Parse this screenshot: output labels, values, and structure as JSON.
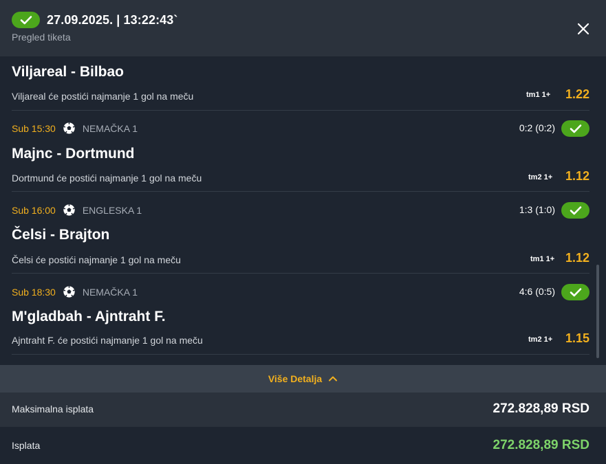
{
  "header": {
    "datetime": "27.09.2025. | 13:22:43`",
    "subtitle": "Pregled tiketa",
    "status_icon": "check-icon",
    "close_icon": "close-icon"
  },
  "colors": {
    "accent": "#f2b01e",
    "success": "#4ca61c",
    "payout": "#7ed46a",
    "background": "#1e2530",
    "panel": "#2b323c"
  },
  "matches": [
    {
      "kickoff": "",
      "league": "",
      "score": "",
      "teams": "Viljareal - Bilbao",
      "pick": "Viljareal će postići najmanje 1 gol na meču",
      "market": "tm1 1+",
      "odds": "1.22",
      "won": false
    },
    {
      "kickoff": "Sub 15:30",
      "league": "NEMAČKA 1",
      "score": "0:2 (0:2)",
      "teams": "Majnc - Dortmund",
      "pick": "Dortmund će postići najmanje 1 gol na meču",
      "market": "tm2 1+",
      "odds": "1.12",
      "won": true
    },
    {
      "kickoff": "Sub 16:00",
      "league": "ENGLESKA 1",
      "score": "1:3 (1:0)",
      "teams": "Čelsi - Brajton",
      "pick": "Čelsi će postići najmanje 1 gol na meču",
      "market": "tm1 1+",
      "odds": "1.12",
      "won": true
    },
    {
      "kickoff": "Sub 18:30",
      "league": "NEMAČKA 1",
      "score": "4:6 (0:5)",
      "teams": "M'gladbah - Ajntraht F.",
      "pick": "Ajntraht F. će postići najmanje 1 gol na meču",
      "market": "tm2 1+",
      "odds": "1.15",
      "won": true
    }
  ],
  "more_details": {
    "label": "Više Detalja",
    "icon": "chevron-up-icon"
  },
  "summary": {
    "max_payout_label": "Maksimalna isplata",
    "max_payout_value": "272.828,89 RSD",
    "payout_label": "Isplata",
    "payout_value": "272.828,89 RSD"
  }
}
